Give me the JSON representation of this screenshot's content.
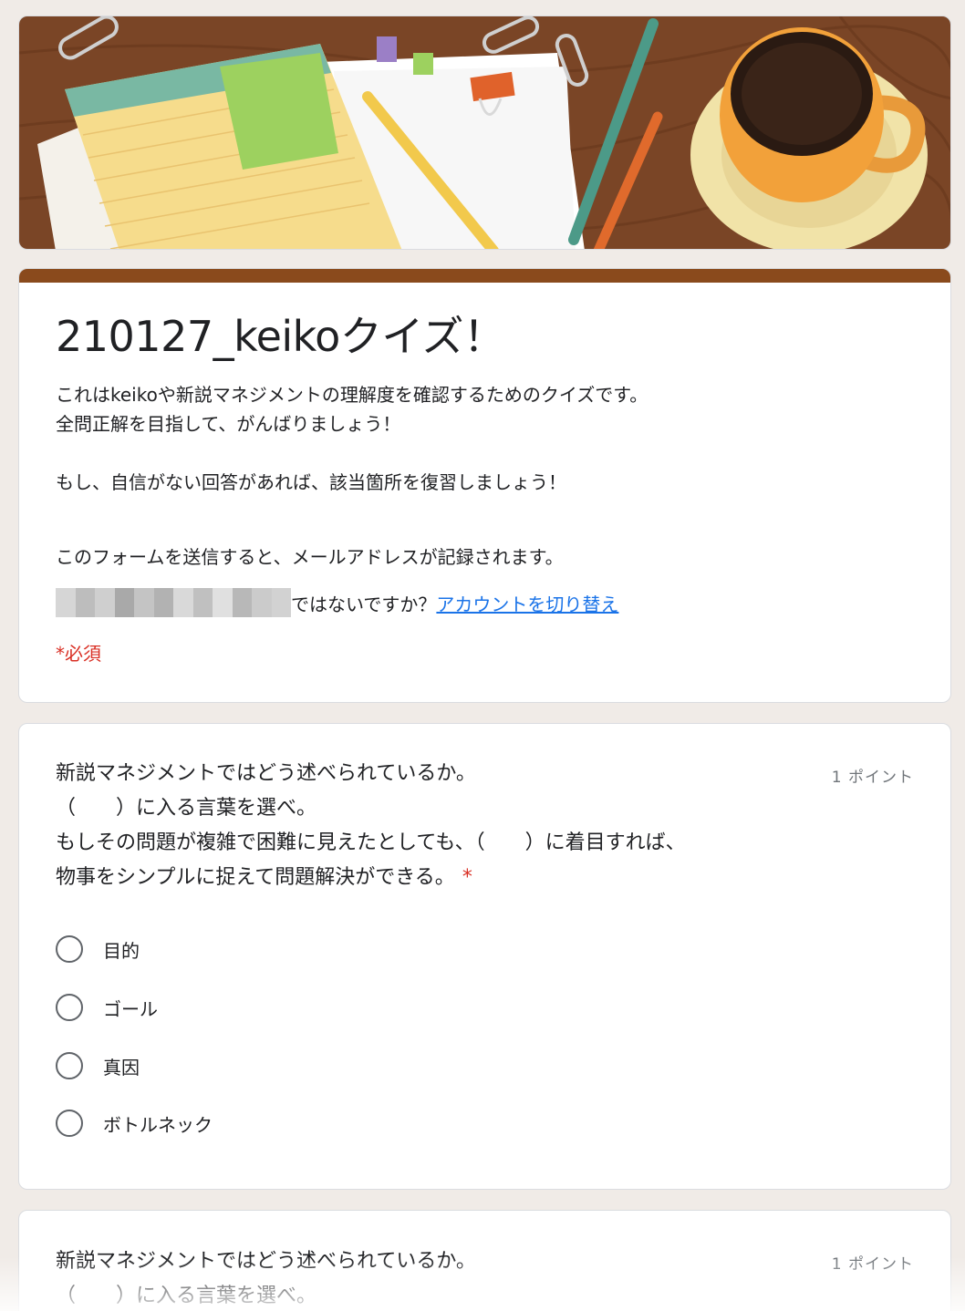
{
  "form": {
    "title": "210127_keikoクイズ！",
    "description_lines": [
      "これはkeikoや新説マネジメントの理解度を確認するためのクイズです。",
      "全問正解を目指して、がんばりましょう！",
      "もし、自信がない回答があれば、該当箇所を復習しましょう！",
      "このフォームを送信すると、メールアドレスが記録されます。"
    ],
    "not_you_text": "ではないですか？",
    "switch_account": "アカウントを切り替え",
    "required_note": "*必須"
  },
  "questions": [
    {
      "lines": [
        "新説マネジメントではどう述べられているか。",
        "（　　）に入る言葉を選べ。",
        "もしその問題が複雑で困難に見えたとしても、（　　）に着目すれば、",
        "物事をシンプルに捉えて問題解決ができる。"
      ],
      "required_star": "*",
      "points": "1 ポイント",
      "options": [
        "目的",
        "ゴール",
        "真因",
        "ボトルネック"
      ]
    },
    {
      "lines": [
        "新説マネジメントではどう述べられているか。",
        "（　　）に入る言葉を選べ。"
      ],
      "points": "1 ポイント"
    }
  ],
  "colors": {
    "accent": "#8a4a1c",
    "required": "#d93025",
    "link": "#1a73e8",
    "page_bg": "#f0ebe7"
  }
}
